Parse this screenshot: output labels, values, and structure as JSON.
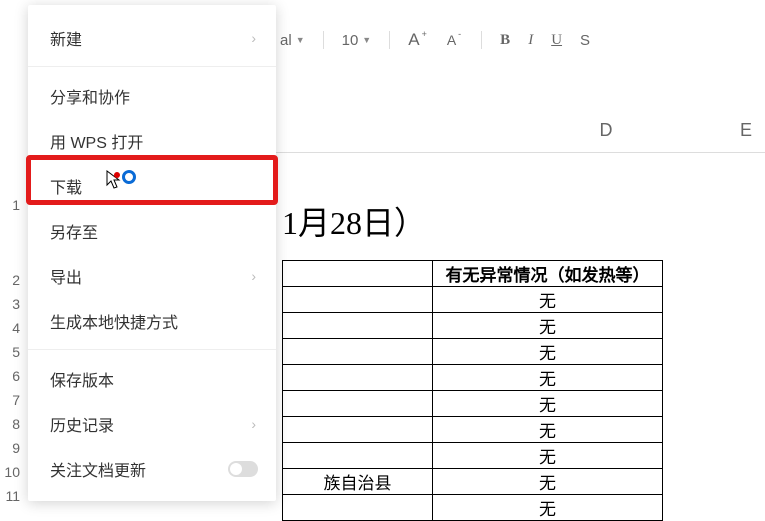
{
  "toolbar": {
    "font_partial": "al",
    "font_size": "10",
    "increase_font": "A",
    "decrease_font": "A",
    "bold": "B",
    "italic": "I",
    "underline": "U",
    "strike_partial": "S"
  },
  "menu": {
    "new": "新建",
    "share": "分享和协作",
    "open_wps": "用 WPS 打开",
    "download": "下载",
    "save_as": "另存至",
    "export": "导出",
    "create_shortcut": "生成本地快捷方式",
    "save_version": "保存版本",
    "history": "历史记录",
    "follow_updates": "关注文档更新"
  },
  "rows": [
    "1",
    "2",
    "3",
    "4",
    "5",
    "6",
    "7",
    "8",
    "9",
    "10",
    "11"
  ],
  "columns": {
    "D": "D",
    "E": "E"
  },
  "title_fragment": "1月28日）",
  "table": {
    "header_col2": "有无异常情况（如发热等）",
    "col1_fragment_row9": "族自治县",
    "rows": [
      "无",
      "无",
      "无",
      "无",
      "无",
      "无",
      "无",
      "无",
      "无"
    ]
  }
}
